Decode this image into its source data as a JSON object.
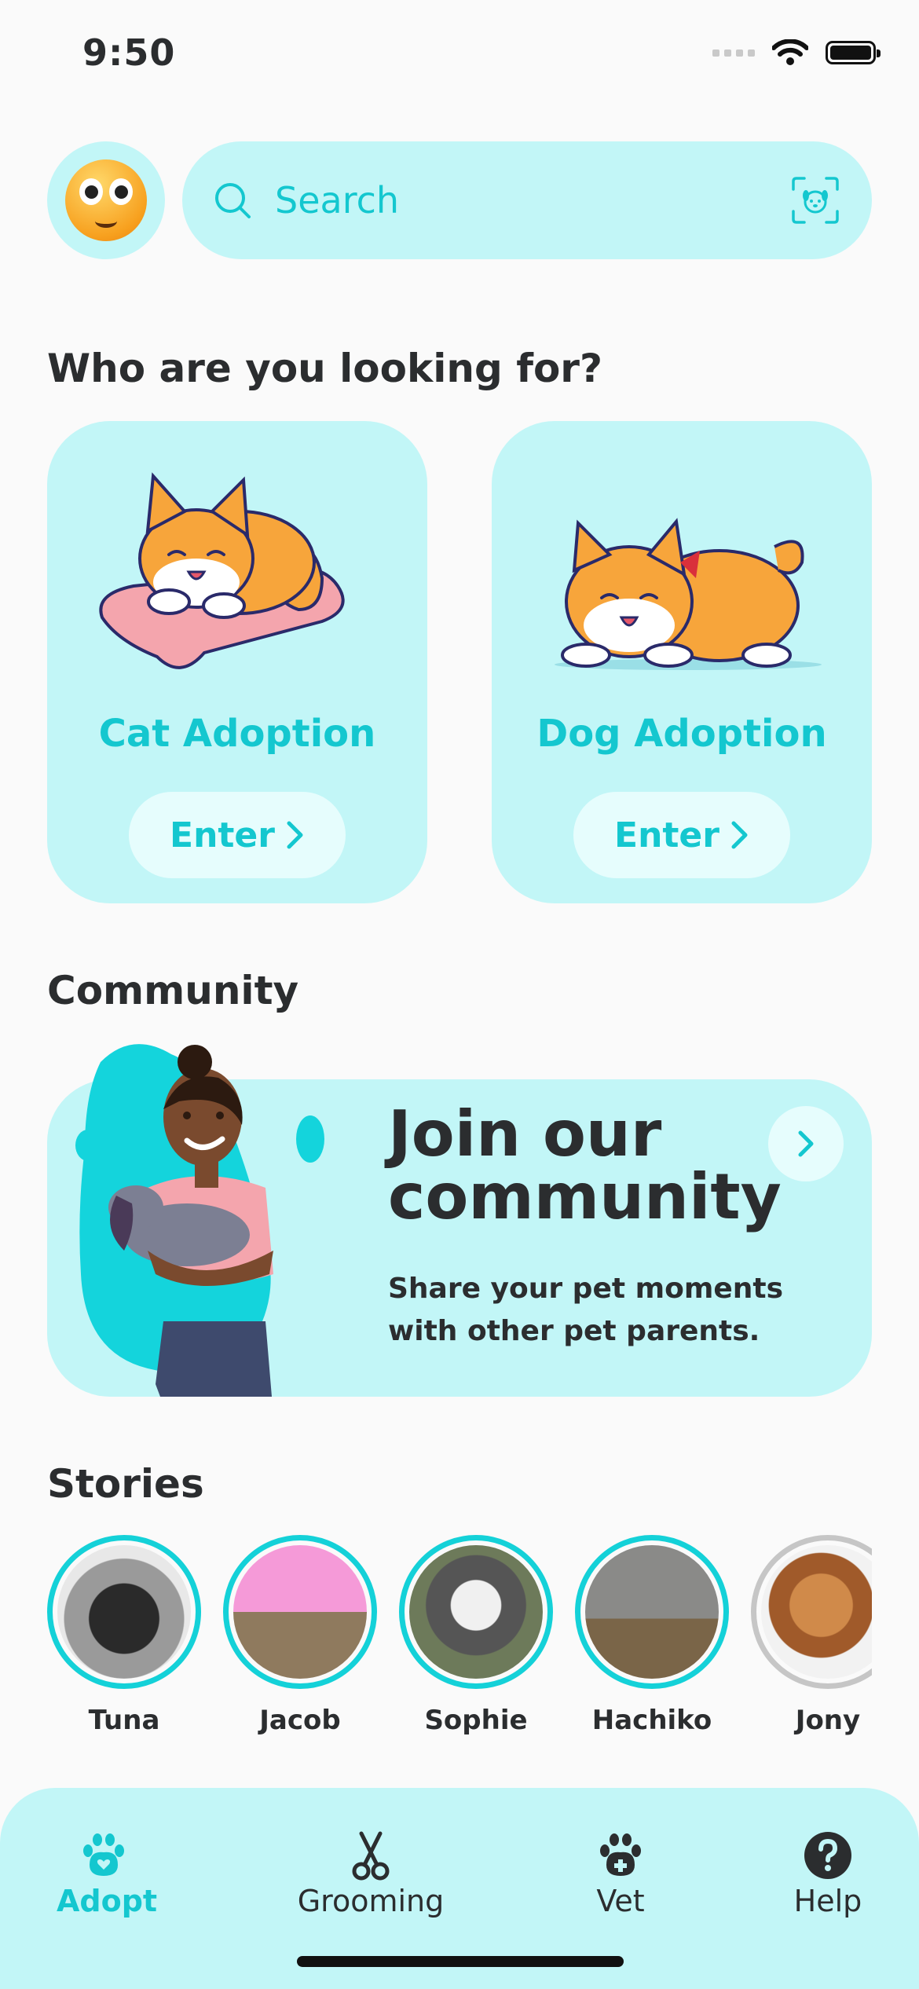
{
  "status_bar": {
    "time": "9:50"
  },
  "search": {
    "placeholder": "Search"
  },
  "sections": {
    "looking_for": "Who are you looking for?",
    "community": "Community",
    "stories": "Stories"
  },
  "adoption_cards": [
    {
      "label": "Cat Adoption",
      "button": "Enter"
    },
    {
      "label": "Dog Adoption",
      "button": "Enter"
    }
  ],
  "community_banner": {
    "title": "Join our community",
    "subtitle": "Share your pet moments with other pet parents."
  },
  "stories": [
    {
      "name": "Tuna",
      "seen": false
    },
    {
      "name": "Jacob",
      "seen": false
    },
    {
      "name": "Sophie",
      "seen": false
    },
    {
      "name": "Hachiko",
      "seen": false
    },
    {
      "name": "Jony",
      "seen": true
    }
  ],
  "bottom_nav": [
    {
      "label": "Adopt",
      "icon": "paw-heart-icon",
      "active": true
    },
    {
      "label": "Grooming",
      "icon": "scissors-icon",
      "active": false
    },
    {
      "label": "Vet",
      "icon": "paw-plus-icon",
      "active": false
    },
    {
      "label": "Help",
      "icon": "help-icon",
      "active": false
    }
  ],
  "colors": {
    "accent": "#14c7cf",
    "card_bg": "#c2f6f7",
    "text_dark": "#2b2d2f",
    "background": "#fafafa"
  }
}
